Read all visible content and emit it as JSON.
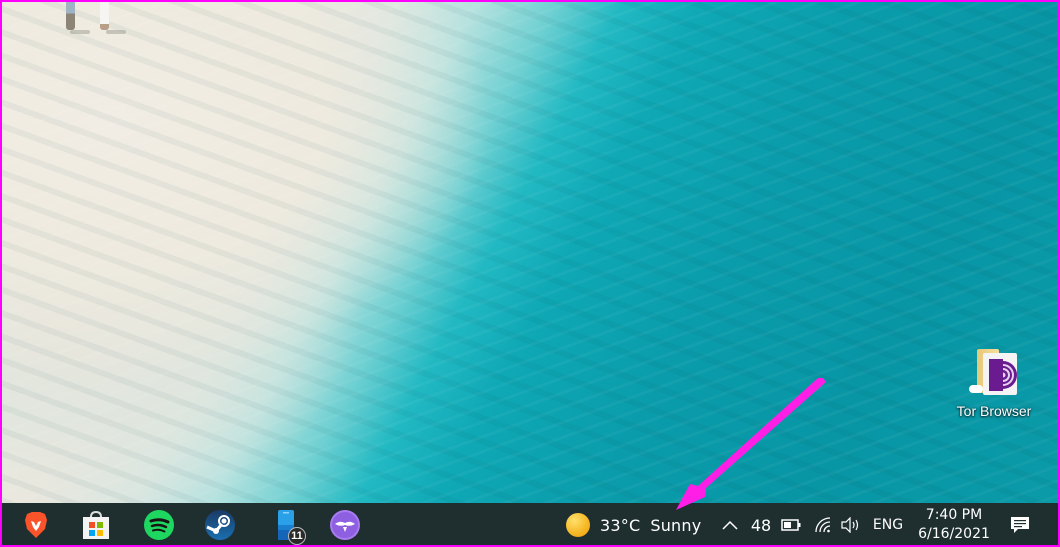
{
  "desktop": {
    "wallpaper": "aerial beach with turquoise water",
    "icons": [
      {
        "label": "Tor Browser",
        "icon": "tor-browser-folder-icon",
        "sync_status": "cloud-icon"
      }
    ]
  },
  "annotation": {
    "type": "arrow",
    "color": "#ff00ff",
    "points_to": "weather-widget"
  },
  "taskbar": {
    "background": "#1f2f30",
    "pinned_apps": [
      {
        "name": "Brave",
        "icon": "brave-lion-icon",
        "color": "#fb542b"
      },
      {
        "name": "Microsoft Store",
        "icon": "microsoft-store-icon"
      },
      {
        "name": "Spotify",
        "icon": "spotify-icon",
        "color": "#1ed760"
      },
      {
        "name": "Steam",
        "icon": "steam-icon",
        "color": "#1b4f8c"
      },
      {
        "name": "Phone",
        "icon": "phone-icon",
        "badge": "11"
      },
      {
        "name": "Privacy app",
        "icon": "mustache-icon",
        "color": "#a97bf0"
      }
    ],
    "weather": {
      "temperature": "33°C",
      "condition": "Sunny",
      "icon": "sun-icon"
    },
    "tray": {
      "chevron": "show-hidden-icons",
      "battery_percent": "48",
      "wifi": "wifi-icon",
      "volume": "volume-icon",
      "language": "ENG"
    },
    "clock": {
      "time": "7:40 PM",
      "date": "6/16/2021"
    },
    "notifications": {
      "icon": "action-center-icon"
    }
  }
}
